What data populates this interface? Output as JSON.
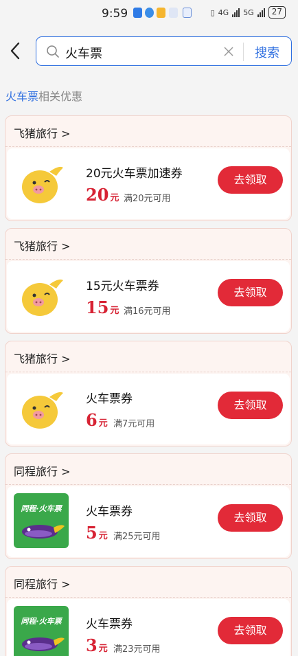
{
  "status_bar": {
    "time": "9:59",
    "network": "4G",
    "network2": "5G",
    "battery": "27"
  },
  "search": {
    "query": "火车票",
    "button": "搜索"
  },
  "section": {
    "keyword": "火车票",
    "suffix": "相关优惠"
  },
  "cards": [
    {
      "brand": "飞猪旅行 >",
      "logo": "fliggy",
      "title": "20元火车票加速券",
      "amount": "20",
      "unit": "元",
      "condition": "满20元可用",
      "action": "去领取"
    },
    {
      "brand": "飞猪旅行 >",
      "logo": "fliggy",
      "title": "15元火车票券",
      "amount": "15",
      "unit": "元",
      "condition": "满16元可用",
      "action": "去领取"
    },
    {
      "brand": "飞猪旅行 >",
      "logo": "fliggy",
      "title": "火车票券",
      "amount": "6",
      "unit": "元",
      "condition": "满7元可用",
      "action": "去领取"
    },
    {
      "brand": "同程旅行 >",
      "logo": "tongcheng",
      "logo_text": "同程·火车票",
      "title": "火车票券",
      "amount": "5",
      "unit": "元",
      "condition": "满25元可用",
      "action": "去领取"
    },
    {
      "brand": "同程旅行 >",
      "logo": "tongcheng",
      "logo_text": "同程·火车票",
      "title": "火车票券",
      "amount": "3",
      "unit": "元",
      "condition": "满23元可用",
      "action": "去领取"
    }
  ]
}
